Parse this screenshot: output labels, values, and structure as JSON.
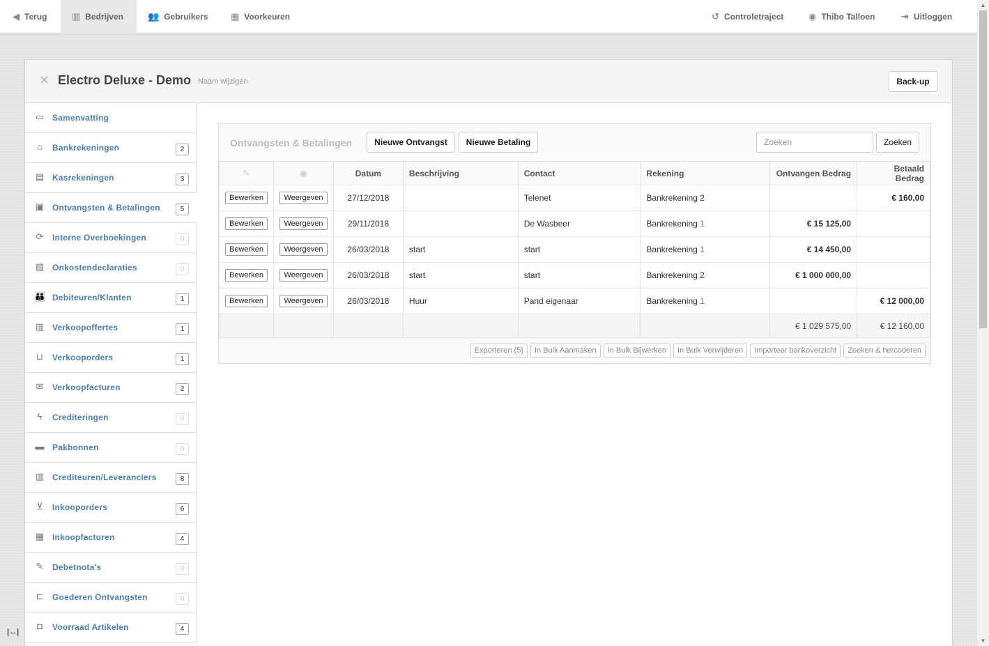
{
  "topnav": {
    "back": "Terug",
    "companies": "Bedrijven",
    "users": "Gebruikers",
    "preferences": "Voorkeuren",
    "control": "Controletraject",
    "user_name": "Thibo Talloen",
    "logout": "Uitloggen"
  },
  "header": {
    "company": "Electro Deluxe - Demo",
    "rename": "Naam wijzigen",
    "backup": "Back-up"
  },
  "sidebar": {
    "items": [
      {
        "label": "Samenvatting",
        "icon": "presentation-icon",
        "badge": ""
      },
      {
        "label": "Bankrekeningen",
        "icon": "bank-icon",
        "badge": "2"
      },
      {
        "label": "Kasrekeningen",
        "icon": "register-icon",
        "badge": "3"
      },
      {
        "label": "Ontvangsten & Betalingen",
        "icon": "payments-icon",
        "badge": "5"
      },
      {
        "label": "Interne Overboekingen",
        "icon": "transfer-icon",
        "badge": "0"
      },
      {
        "label": "Onkostendeclaraties",
        "icon": "expense-icon",
        "badge": "0"
      },
      {
        "label": "Debiteuren/Klanten",
        "icon": "people-icon",
        "badge": "1"
      },
      {
        "label": "Verkoopoffertes",
        "icon": "quote-icon",
        "badge": "1"
      },
      {
        "label": "Verkooporders",
        "icon": "basket-icon",
        "badge": "1"
      },
      {
        "label": "Verkoopfacturen",
        "icon": "invoice-icon",
        "badge": "2"
      },
      {
        "label": "Crediteringen",
        "icon": "lightning-icon",
        "badge": "0"
      },
      {
        "label": "Pakbonnen",
        "icon": "truck-icon",
        "badge": "0"
      },
      {
        "label": "Crediteuren/Leveranciers",
        "icon": "building-icon",
        "badge": "8"
      },
      {
        "label": "Inkooporders",
        "icon": "cart-icon",
        "badge": "6"
      },
      {
        "label": "Inkoopfacturen",
        "icon": "calendar-icon",
        "badge": "4"
      },
      {
        "label": "Debetnota's",
        "icon": "note-icon",
        "badge": "0"
      },
      {
        "label": "Goederen Ontvangsten",
        "icon": "dolly-icon",
        "badge": "0"
      },
      {
        "label": "Voorraad Artikelen",
        "icon": "box-icon",
        "badge": "4"
      }
    ]
  },
  "main": {
    "title": "Ontvangsten & Betalingen",
    "new_receipt": "Nieuwe Ontvangst",
    "new_payment": "Nieuwe Betaling",
    "search_placeholder": "Zoeken",
    "search_button": "Zoeken",
    "columns": {
      "date": "Datum",
      "description": "Beschrijving",
      "contact": "Contact",
      "account": "Rekening",
      "received": "Ontvangen Bedrag",
      "paid": "Betaald Bedrag"
    },
    "edit_label": "Bewerken",
    "view_label": "Weergeven",
    "rows": [
      {
        "date": "27/12/2018",
        "description": "",
        "contact": "Telenet",
        "account_name": "Bankrekening",
        "account_no": "2",
        "received": "",
        "paid": "€ 160,00"
      },
      {
        "date": "29/11/2018",
        "description": "",
        "contact": "De Wasbeer",
        "account_name": "Bankrekening",
        "account_no": "1",
        "received": "€ 15 125,00",
        "paid": ""
      },
      {
        "date": "26/03/2018",
        "description": "start",
        "contact": "start",
        "account_name": "Bankrekening",
        "account_no": "1",
        "received": "€ 14 450,00",
        "paid": ""
      },
      {
        "date": "26/03/2018",
        "description": "start",
        "contact": "start",
        "account_name": "Bankrekening",
        "account_no": "2",
        "received": "€ 1 000 000,00",
        "paid": ""
      },
      {
        "date": "26/03/2018",
        "description": "Huur",
        "contact": "Pand eigenaar",
        "account_name": "Bankrekening",
        "account_no": "1",
        "received": "",
        "paid": "€ 12 000,00"
      }
    ],
    "totals": {
      "received": "€ 1 029 575,00",
      "paid": "€ 12 160,00"
    },
    "footer_buttons": [
      "Exporteren (5)",
      "In Bulk Aanmaken",
      "In Bulk Bijwerken",
      "In Bulk Verwijderen",
      "Importeer bankoverzicht",
      "Zoeken & hercoderen"
    ]
  },
  "colors": {
    "link": "#4a7fb5",
    "muted": "#bbbbbb"
  }
}
